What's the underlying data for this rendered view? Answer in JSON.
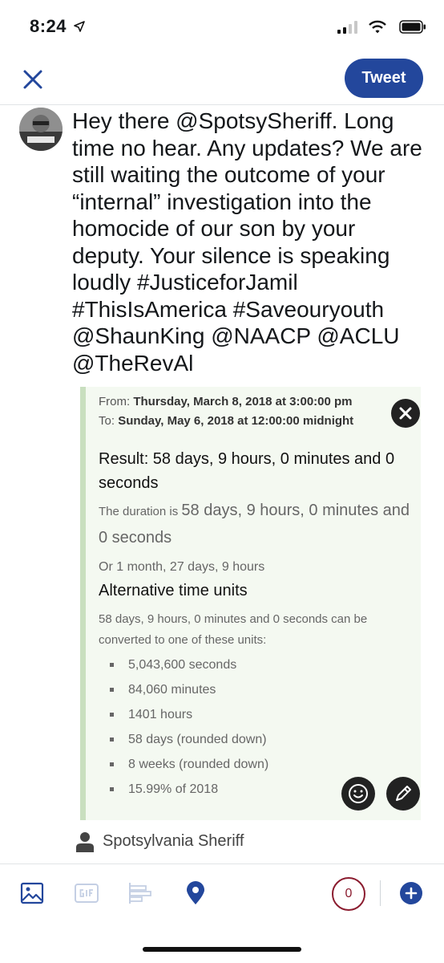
{
  "status_bar": {
    "time": "8:24"
  },
  "header": {
    "tweet_label": "Tweet"
  },
  "tweet": {
    "text": "Hey there @SpotsySheriff. Long\ntime no hear. Any updates? We are\nstill waiting the outcome of your\n“internal” investigation into the\nhomocide of our son by your\ndeputy. Your silence is speaking\nloudly #JusticeforJamil\n#ThisIsAmerica #Saveouryouth\n@ShaunKing @NAACP @ACLU\n@TheRevAl"
  },
  "attachment": {
    "from_label": "From:",
    "from_value": "Thursday, March 8, 2018 at 3:00:00 pm",
    "to_label": "To:",
    "to_value": "Sunday, May 6, 2018 at 12:00:00 midnight",
    "result": "Result: 58 days, 9 hours, 0 minutes and 0 seconds",
    "duration_prefix": "The duration is",
    "duration_value": "58 days, 9 hours, 0 minutes and 0 seconds",
    "or_line": "Or 1 month, 27 days, 9 hours",
    "alt_title": "Alternative time units",
    "convert_text": "58 days, 9 hours, 0 minutes and 0 seconds can be converted to one of these units:",
    "units": [
      "5,043,600 seconds",
      "84,060 minutes",
      "1401 hours",
      "58 days (rounded down)",
      "8 weeks (rounded down)",
      "15.99% of 2018"
    ]
  },
  "location": {
    "label": "Spotsylvania Sheriff"
  },
  "toolbar": {
    "counter": "0"
  },
  "colors": {
    "accent": "#23479c",
    "counter_ring": "#8b1c2f",
    "attachment_bg": "#f4f9f1",
    "attachment_border": "#c9dfbf"
  },
  "icons": [
    "location-arrow-icon",
    "cellular-signal-icon",
    "wifi-icon",
    "battery-icon",
    "close-icon",
    "remove-icon",
    "emoji-icon",
    "pencil-icon",
    "person-icon",
    "image-icon",
    "gif-icon",
    "poll-icon",
    "location-pin-icon",
    "plus-icon"
  ]
}
